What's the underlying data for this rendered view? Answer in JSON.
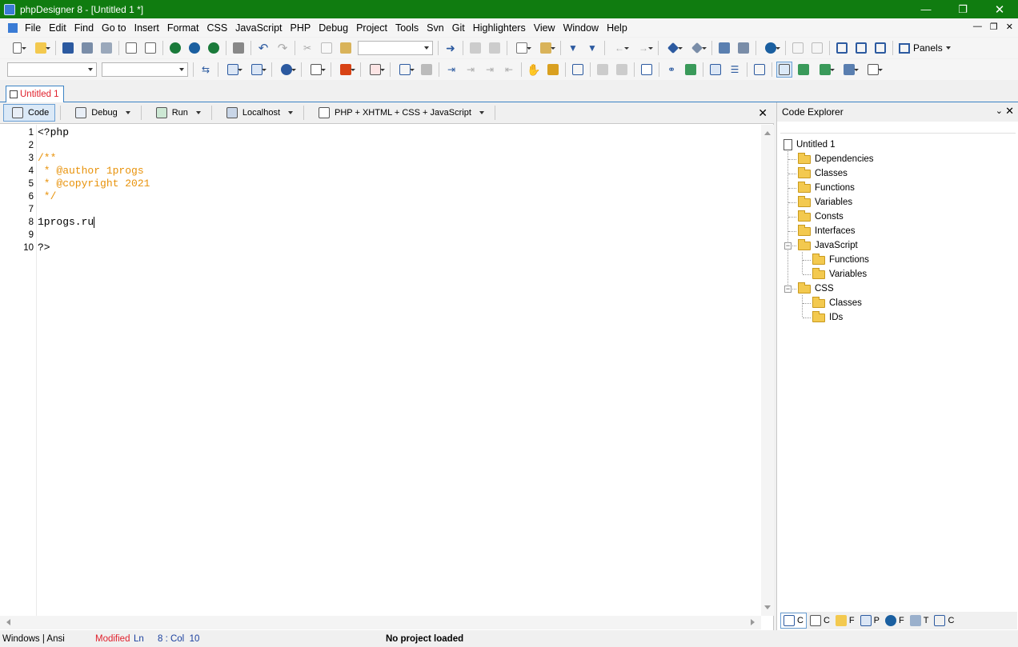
{
  "window": {
    "title": "phpDesigner 8 - [Untitled 1 *]"
  },
  "menu": [
    "File",
    "Edit",
    "Find",
    "Go to",
    "Insert",
    "Format",
    "CSS",
    "JavaScript",
    "PHP",
    "Debug",
    "Project",
    "Tools",
    "Svn",
    "Git",
    "Highlighters",
    "View",
    "Window",
    "Help"
  ],
  "toolbar": {
    "panels_label": "Panels"
  },
  "doc_tab": {
    "label": "Untitled 1"
  },
  "mode_bar": {
    "code": "Code",
    "debug": "Debug",
    "run": "Run",
    "localhost": "Localhost",
    "highlighter": "PHP + XHTML + CSS + JavaScript"
  },
  "editor": {
    "lines": [
      {
        "n": "1",
        "text": "<?php",
        "type": "plain"
      },
      {
        "n": "2",
        "text": "",
        "type": "plain"
      },
      {
        "n": "3",
        "text": "/**",
        "type": "comment"
      },
      {
        "n": "4",
        "text": " * @author 1progs",
        "type": "comment"
      },
      {
        "n": "5",
        "text": " * @copyright 2021",
        "type": "comment"
      },
      {
        "n": "6",
        "text": " */",
        "type": "comment"
      },
      {
        "n": "7",
        "text": "",
        "type": "plain"
      },
      {
        "n": "8",
        "text": "1progs.ru",
        "type": "plain"
      },
      {
        "n": "9",
        "text": "",
        "type": "plain"
      },
      {
        "n": "10",
        "text": "?>",
        "type": "plain"
      }
    ]
  },
  "explorer": {
    "title": "Code Explorer",
    "root": "Untitled 1",
    "items": [
      "Dependencies",
      "Classes",
      "Functions",
      "Variables",
      "Consts",
      "Interfaces"
    ],
    "javascript": {
      "label": "JavaScript",
      "children": [
        "Functions",
        "Variables"
      ]
    },
    "css": {
      "label": "CSS",
      "children": [
        "Classes",
        "IDs"
      ]
    },
    "tabs": [
      "C",
      "C",
      "F",
      "P",
      "F",
      "T",
      "C"
    ]
  },
  "status": {
    "encoding": "Windows | Ansi",
    "modified": "Modified",
    "ln_label": "Ln",
    "position": "8 : Col  10",
    "project": "No project loaded"
  },
  "colors": {
    "titlebar": "#107c10",
    "comment": "#e8920a",
    "tab_text": "#e0202c",
    "accent": "#3b82c4"
  }
}
